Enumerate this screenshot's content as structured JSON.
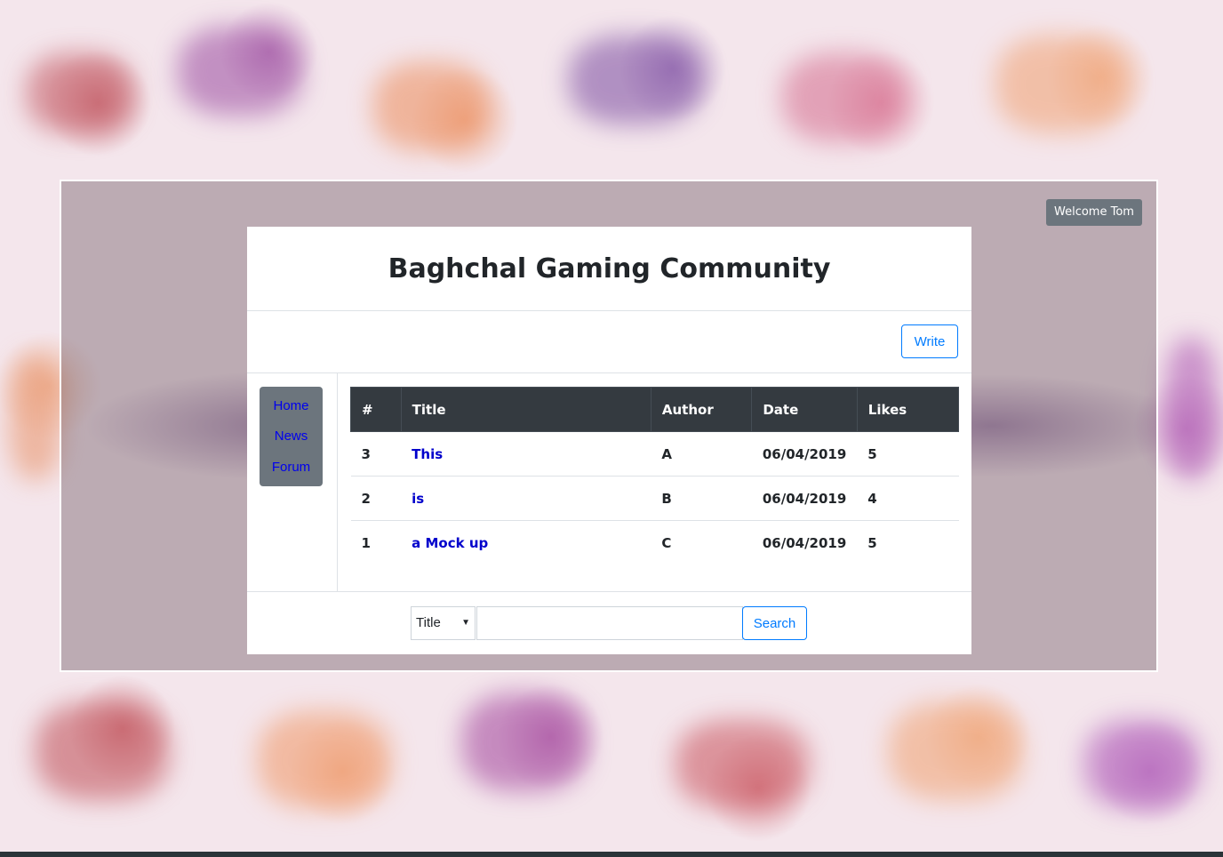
{
  "header": {
    "welcome": "Welcome Tom"
  },
  "site": {
    "title": "Baghchal Gaming Community"
  },
  "toolbar": {
    "write_label": "Write"
  },
  "sidebar": {
    "items": [
      {
        "label": "Home"
      },
      {
        "label": "News"
      },
      {
        "label": "Forum"
      }
    ]
  },
  "table": {
    "columns": [
      "#",
      "Title",
      "Author",
      "Date",
      "Likes"
    ],
    "rows": [
      {
        "num": "3",
        "title": "This",
        "author": "A",
        "date": "06/04/2019",
        "likes": "5"
      },
      {
        "num": "2",
        "title": "is",
        "author": "B",
        "date": "06/04/2019",
        "likes": "4"
      },
      {
        "num": "1",
        "title": "a Mock up",
        "author": "C",
        "date": "06/04/2019",
        "likes": "5"
      }
    ]
  },
  "search": {
    "field_selected": "Title",
    "query": "",
    "button_label": "Search"
  },
  "colors": {
    "accent": "#007bff",
    "table_header": "#343a40",
    "nav_bg": "#6c757d",
    "link": "#0000cc"
  }
}
